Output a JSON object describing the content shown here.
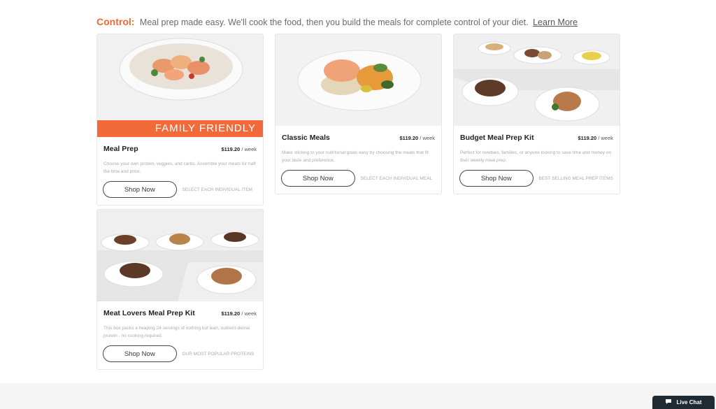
{
  "intro": {
    "label": "Control:",
    "text": "Meal prep made easy. We'll cook the food, then you build the meals for complete control of your diet.",
    "link": "Learn More"
  },
  "cards": [
    {
      "title": "Meal Prep",
      "price": "$119.20",
      "unit": "/ week",
      "banner": "FAMILY FRIENDLY",
      "desc": "Choose your own protein, veggies, and carbs. Assemble your meals for half the time and price.",
      "button": "Shop Now",
      "note": "SELECT EACH INDIVIDUAL ITEM"
    },
    {
      "title": "Classic Meals",
      "price": "$119.20",
      "unit": "/ week",
      "desc": "Make sticking to your nutritional goals easy by choosing the meals that fit your taste and preference.",
      "button": "Shop Now",
      "note": "SELECT EACH INDIVIDUAL MEAL"
    },
    {
      "title": "Budget Meal Prep Kit",
      "price": "$119.20",
      "unit": "/ week",
      "desc": "Perfect for newbies, families, or anyone looking to save time and money on their weekly meal prep.",
      "button": "Shop Now",
      "note": "BEST SELLING MEAL PREP ITEMS"
    },
    {
      "title": "Meat Lovers Meal Prep Kit",
      "price": "$119.20",
      "unit": "/ week",
      "desc": "This box packs a heaping 24 servings of nothing but lean, nutrient-dense protein - no cooking required.",
      "button": "Shop Now",
      "note": "OUR MOST POPULAR PROTEINS"
    }
  ],
  "chat": {
    "label": "Live Chat"
  },
  "colors": {
    "accent": "#ef6a35",
    "button_border": "#3a4750",
    "chat_bg": "#1f2a33"
  }
}
